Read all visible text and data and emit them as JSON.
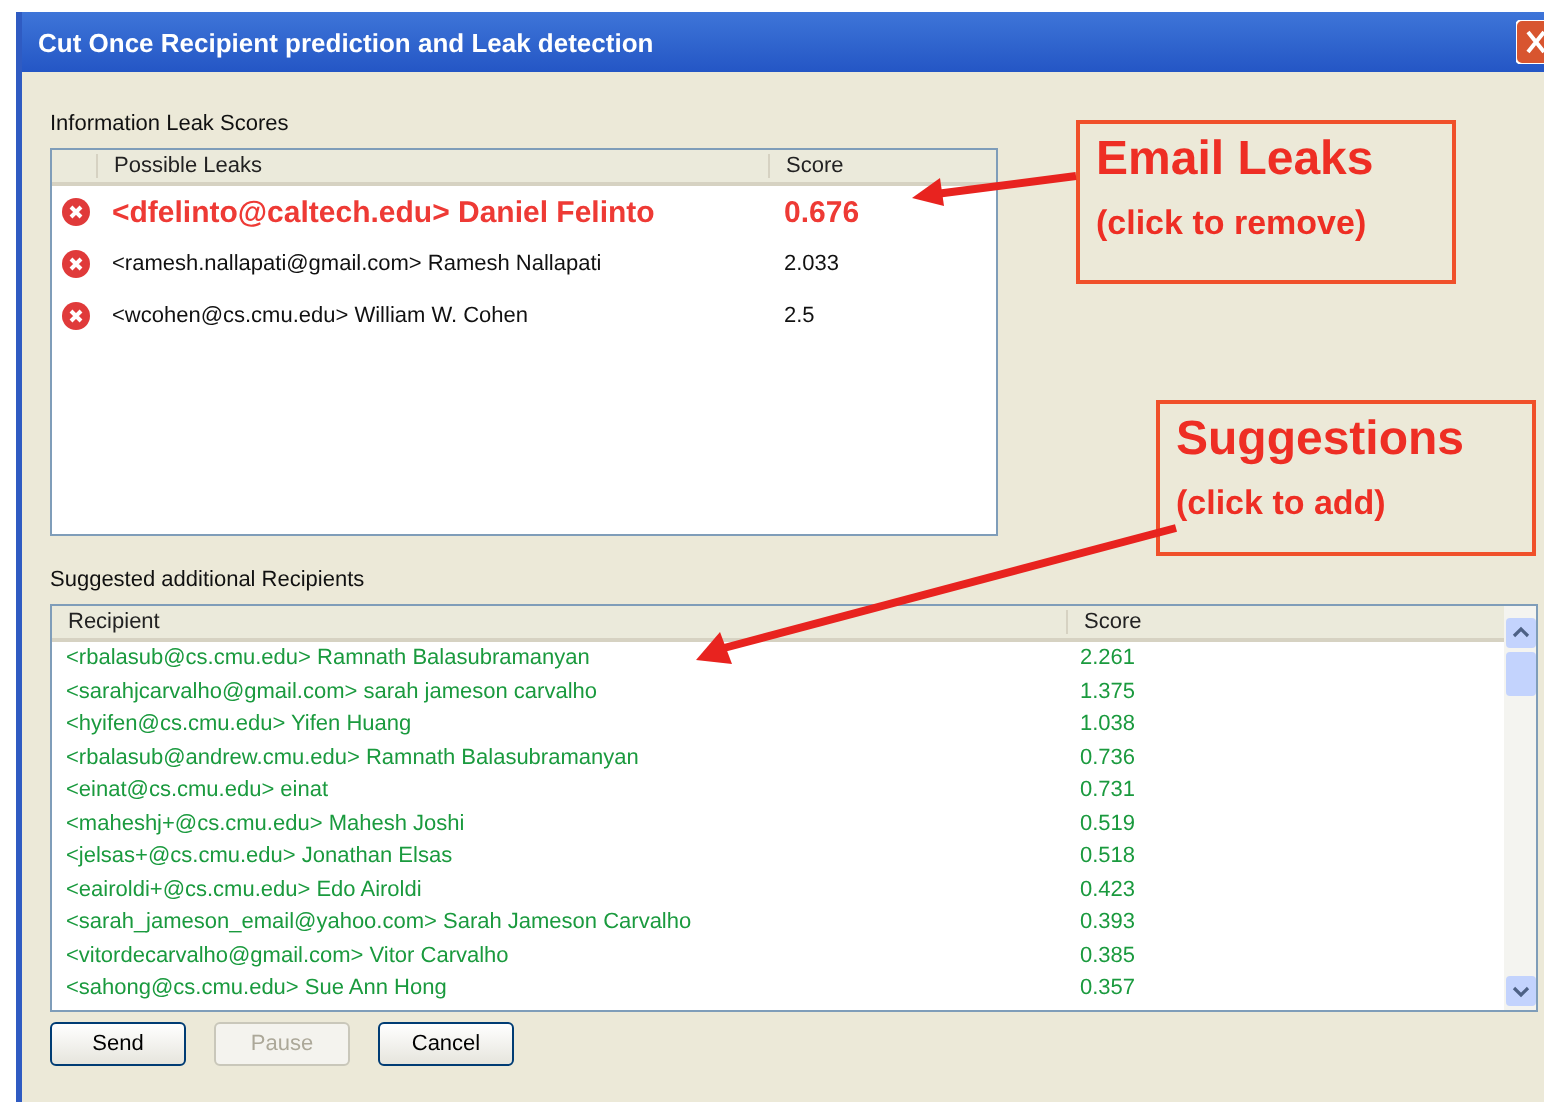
{
  "window": {
    "title": "Cut Once Recipient prediction and Leak detection"
  },
  "leaks": {
    "label": "Information Leak Scores",
    "columns": [
      "Possible Leaks",
      "Score"
    ],
    "rows": [
      {
        "recipient": "<dfelinto@caltech.edu> Daniel Felinto",
        "score": "0.676",
        "highlighted": true
      },
      {
        "recipient": "<ramesh.nallapati@gmail.com> Ramesh Nallapati",
        "score": "2.033",
        "highlighted": false
      },
      {
        "recipient": "<wcohen@cs.cmu.edu> William W. Cohen",
        "score": "2.5",
        "highlighted": false
      }
    ]
  },
  "suggestions": {
    "label": "Suggested additional Recipients",
    "columns": [
      "Recipient",
      "Score"
    ],
    "rows": [
      {
        "recipient": "<rbalasub@cs.cmu.edu> Ramnath Balasubramanyan",
        "score": "2.261"
      },
      {
        "recipient": "<sarahjcarvalho@gmail.com> sarah jameson carvalho",
        "score": "1.375"
      },
      {
        "recipient": "<hyifen@cs.cmu.edu> Yifen Huang",
        "score": "1.038"
      },
      {
        "recipient": "<rbalasub@andrew.cmu.edu> Ramnath Balasubramanyan",
        "score": "0.736"
      },
      {
        "recipient": "<einat@cs.cmu.edu> einat",
        "score": "0.731"
      },
      {
        "recipient": "<maheshj+@cs.cmu.edu> Mahesh Joshi",
        "score": "0.519"
      },
      {
        "recipient": "<jelsas+@cs.cmu.edu> Jonathan Elsas",
        "score": "0.518"
      },
      {
        "recipient": "<eairoldi+@cs.cmu.edu> Edo Airoldi",
        "score": "0.423"
      },
      {
        "recipient": "<sarah_jameson_email@yahoo.com> Sarah Jameson Carvalho",
        "score": "0.393"
      },
      {
        "recipient": "<vitordecarvalho@gmail.com> Vitor Carvalho",
        "score": "0.385"
      },
      {
        "recipient": "<sahong@cs.cmu.edu> Sue Ann Hong",
        "score": "0.357"
      }
    ]
  },
  "buttons": [
    {
      "label": "Send",
      "disabled": false
    },
    {
      "label": "Pause",
      "disabled": true
    },
    {
      "label": "Cancel",
      "disabled": false
    }
  ],
  "callouts": [
    {
      "title": "Email Leaks",
      "subtitle": "(click to remove)"
    },
    {
      "title": "Suggestions",
      "subtitle": "(click to add)"
    }
  ]
}
